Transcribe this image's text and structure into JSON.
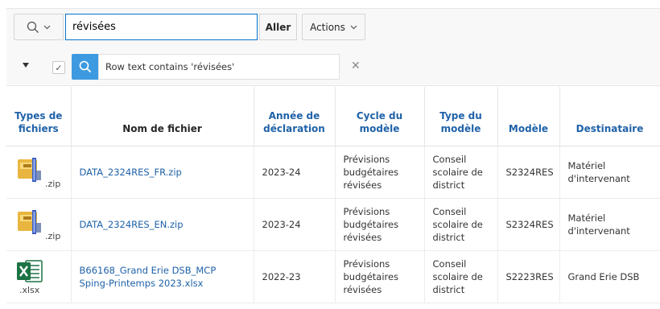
{
  "toolbar": {
    "search_value": "révisées",
    "go_label": "Aller",
    "actions_label": "Actions"
  },
  "filter": {
    "text": "Row text contains 'révisées'",
    "remove_glyph": "✕",
    "check_glyph": "✓"
  },
  "table": {
    "headers": {
      "types": "Types de fichiers",
      "nom": "Nom de fichier",
      "annee": "Année de déclaration",
      "cycle": "Cycle du modèle",
      "type": "Type du modèle",
      "modele": "Modèle",
      "destinataire": "Destinataire"
    },
    "rows": [
      {
        "ext": ".zip",
        "icon": "zip-archive-icon",
        "nom": "DATA_2324RES_FR.zip",
        "annee": "2023-24",
        "cycle": "Prévisions budgétaires révisées",
        "type": "Conseil scolaire de district",
        "modele": "S2324RES",
        "destinataire": "Matériel d'intervenant"
      },
      {
        "ext": ".zip",
        "icon": "zip-archive-icon",
        "nom": "DATA_2324RES_EN.zip",
        "annee": "2023-24",
        "cycle": "Prévisions budgétaires révisées",
        "type": "Conseil scolaire de district",
        "modele": "S2324RES",
        "destinataire": "Matériel d'intervenant"
      },
      {
        "ext": ".xlsx",
        "icon": "excel-icon",
        "nom": "B66168_Grand Erie DSB_MCP Sping-Printemps 2023.xlsx",
        "annee": "2022-23",
        "cycle": "Prévisions budgétaires révisées",
        "type": "Conseil scolaire de district",
        "modele": "S2223RES",
        "destinataire": "Grand Erie DSB"
      }
    ]
  },
  "colors": {
    "link": "#1f62a8",
    "accent": "#3d9ae0",
    "excel_green": "#1d7345"
  }
}
